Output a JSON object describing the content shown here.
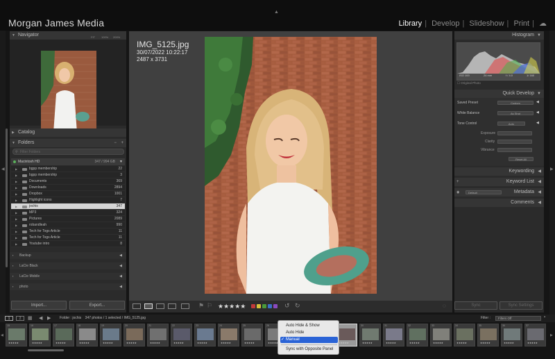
{
  "app": {
    "brand": "Morgan James Media",
    "modules": [
      "Library",
      "Develop",
      "Slideshow",
      "Print"
    ],
    "active_module": "Library",
    "separator": "|"
  },
  "left_panel": {
    "navigator": {
      "title": "Navigator",
      "zoom_options": [
        "FIT",
        "100%",
        "200%"
      ]
    },
    "catalog": {
      "title": "Catalog"
    },
    "folders": {
      "title": "Folders",
      "search_placeholder": "Filter Folders",
      "volume": {
        "name": "Macintosh HD",
        "stats": "347 / 994 GB"
      },
      "items": [
        {
          "name": "bgpp membership",
          "count": "22"
        },
        {
          "name": "bgpp membership",
          "count": "3"
        },
        {
          "name": "Documents",
          "count": "369"
        },
        {
          "name": "Downloads",
          "count": "2894"
        },
        {
          "name": "Dropbox",
          "count": "1001"
        },
        {
          "name": "Highlight icons",
          "count": "7"
        },
        {
          "name": "jochis",
          "count": "347",
          "selected": true
        },
        {
          "name": "MP3",
          "count": "324"
        },
        {
          "name": "Pictures",
          "count": "2089"
        },
        {
          "name": "robandleah",
          "count": "990"
        },
        {
          "name": "Tech for Togs Article",
          "count": "11"
        },
        {
          "name": "Tech for Togs Article",
          "count": "11"
        },
        {
          "name": "Youtube intro",
          "count": "8"
        }
      ],
      "other_volumes": [
        "Backup",
        "LaCie Black",
        "LaCie Mobile",
        "photo"
      ]
    },
    "import_label": "Import...",
    "export_label": "Export..."
  },
  "photo": {
    "filename": "IMG_5125.jpg",
    "datetime": "30/07/2022 10:22:17",
    "dimensions": "2487 x 3731"
  },
  "toolbar": {
    "stars": "★★★★★",
    "color_labels": [
      "#c03a3a",
      "#d6c23a",
      "#4a9a3a",
      "#3a70c8",
      "#8a4ac0"
    ]
  },
  "right_panel": {
    "histogram": {
      "title": "Histogram",
      "readout": [
        "ISO 100",
        "24 mm",
        "f / 4.0",
        "1/ 160"
      ],
      "original_photo": "Original Photo"
    },
    "quick_develop": {
      "title": "Quick Develop",
      "saved_preset_label": "Saved Preset",
      "saved_preset_value": "Custom",
      "white_balance_label": "White Balance",
      "white_balance_value": "As Shot",
      "tone_control_label": "Tone Control",
      "auto_label": "Auto",
      "exposure_label": "Exposure",
      "clarity_label": "Clarity",
      "vibrance_label": "Vibrance",
      "reset_label": "Reset All"
    },
    "keywording": "Keywording",
    "keyword_list": "Keyword List",
    "metadata": "Metadata",
    "metadata_preset": "Default",
    "comments": "Comments",
    "sync_label": "Sync",
    "sync_settings_label": "Sync Settings"
  },
  "filmstrip_bar": {
    "pages": [
      "1",
      "2"
    ],
    "path": "Folder : jochis    347 photos / 1 selected / IMG_5125.jpg",
    "filter_label": "Filter :",
    "filter_value": "Filters Off"
  },
  "filmstrip": {
    "stars": "★★★★★",
    "numbers": [
      "15",
      "16",
      "17",
      "18",
      "19",
      "20",
      "21",
      "22",
      "23",
      "24",
      "25",
      "26",
      "27",
      "28",
      "29",
      "30",
      "31",
      "32",
      "33",
      "34",
      "35",
      "36",
      "37"
    ]
  },
  "popup_menu": {
    "items": [
      "Auto Hide & Show",
      "Auto Hide",
      "Manual",
      "Sync with Opposite Panel"
    ],
    "checked": "Manual",
    "check_mark": "✓"
  }
}
